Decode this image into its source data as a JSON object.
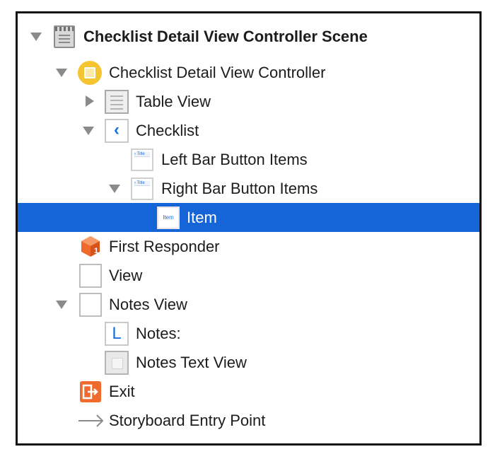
{
  "outline": {
    "scene": {
      "label": "Checklist Detail View Controller Scene",
      "icon": "scene-icon"
    },
    "view_controller": {
      "label": "Checklist Detail View Controller",
      "icon": "view-controller-icon"
    },
    "table_view": {
      "label": "Table View",
      "icon": "table-view-icon"
    },
    "navigation_item": {
      "label": "Checklist",
      "icon": "navigation-item-icon"
    },
    "left_bar_items": {
      "label": "Left Bar Button Items",
      "icon": "bar-button-items-icon"
    },
    "right_bar_items": {
      "label": "Right Bar Button Items",
      "icon": "bar-button-items-icon"
    },
    "bar_item": {
      "label": "Item",
      "icon": "bar-button-item-icon",
      "icon_text": "Item",
      "selected": true
    },
    "first_responder": {
      "label": "First Responder",
      "icon": "first-responder-icon"
    },
    "view": {
      "label": "View",
      "icon": "view-icon"
    },
    "notes_view": {
      "label": "Notes View",
      "icon": "view-icon"
    },
    "notes_label": {
      "label": "Notes:",
      "icon": "label-icon",
      "icon_text": "L"
    },
    "notes_text_view": {
      "label": "Notes Text View",
      "icon": "text-view-icon"
    },
    "exit": {
      "label": "Exit",
      "icon": "exit-icon"
    },
    "entry_point": {
      "label": "Storyboard Entry Point",
      "icon": "arrow-right-icon"
    }
  },
  "colors": {
    "selection": "#1565d8",
    "disclosure_triangle": "#8b8b8b",
    "view_controller_yellow": "#f5c431",
    "first_responder_orange": "#ef6a2c",
    "exit_orange": "#ef6a2c",
    "link_blue": "#1a6fe0"
  }
}
